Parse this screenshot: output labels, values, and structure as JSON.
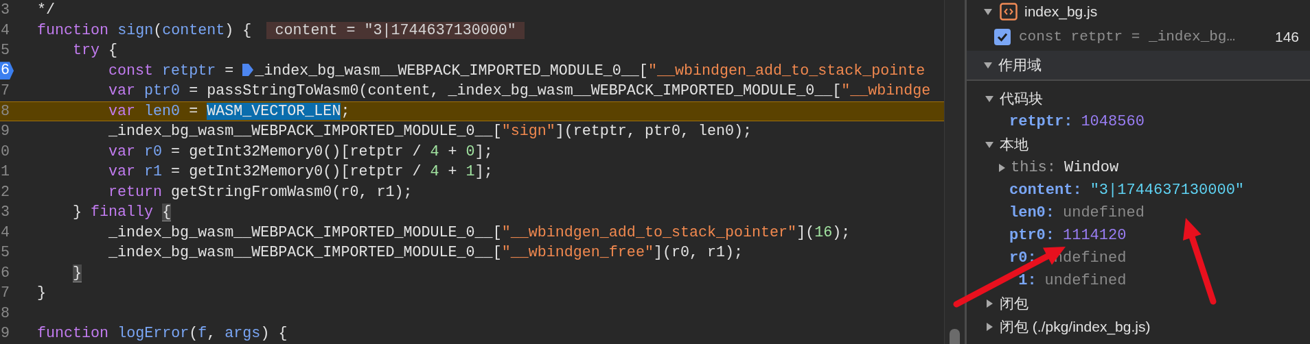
{
  "editor": {
    "lines": [
      {
        "number": "3",
        "breakpoint": false,
        "paused": false,
        "tokens": [
          {
            "kind": "plain",
            "text": "*/"
          }
        ]
      },
      {
        "number": "4",
        "breakpoint": false,
        "paused": false,
        "tokens": [
          {
            "kind": "keyword",
            "text": "function"
          },
          {
            "kind": "ident",
            "text": "sign"
          },
          {
            "kind": "plain",
            "text": "("
          },
          {
            "kind": "ident",
            "text": "content"
          },
          {
            "kind": "plain",
            "text": ") {"
          },
          {
            "kind": "inline-value",
            "text": "content = \"3|1744637130000\""
          }
        ],
        "children": [
          {
            "number": "5",
            "breakpoint": false,
            "paused": false,
            "tokens": [
              {
                "kind": "keyword",
                "text": "try"
              },
              {
                "kind": "plain",
                "text": "{"
              }
            ],
            "children": [
              {
                "number": "6",
                "breakpoint": true,
                "paused": false,
                "tokens": [
                  {
                    "kind": "keyword",
                    "text": "const"
                  },
                  {
                    "kind": "ident",
                    "text": "retptr"
                  },
                  {
                    "kind": "plain",
                    "text": " = "
                  },
                  {
                    "kind": "column-breakpoint"
                  },
                  {
                    "kind": "plain",
                    "text": "_index_bg_wasm__WEBPACK_IMPORTED_MODULE_0__["
                  },
                  {
                    "kind": "string",
                    "text": "\"__wbindgen_add_to_stack_pointe"
                  }
                ]
              },
              {
                "number": "7",
                "breakpoint": false,
                "paused": false,
                "tokens": [
                  {
                    "kind": "keyword",
                    "text": "var"
                  },
                  {
                    "kind": "ident",
                    "text": "ptr0"
                  },
                  {
                    "kind": "plain",
                    "text": " = passStringToWasm0(content, _index_bg_wasm__WEBPACK_IMPORTED_MODULE_0__["
                  },
                  {
                    "kind": "string",
                    "text": "\"__wbindge"
                  }
                ]
              },
              {
                "number": "8",
                "breakpoint": false,
                "paused": true,
                "tokens": [
                  {
                    "kind": "keyword",
                    "text": "var"
                  },
                  {
                    "kind": "ident",
                    "text": "len0"
                  },
                  {
                    "kind": "plain",
                    "text": " = "
                  },
                  {
                    "kind": "selected",
                    "text": "WASM_VECTOR_LEN"
                  },
                  {
                    "kind": "plain",
                    "text": ";"
                  }
                ]
              },
              {
                "number": "9",
                "breakpoint": false,
                "paused": false,
                "tokens": [
                  {
                    "kind": "plain",
                    "text": "_index_bg_wasm__WEBPACK_IMPORTED_MODULE_0__["
                  },
                  {
                    "kind": "string",
                    "text": "\"sign\""
                  },
                  {
                    "kind": "plain",
                    "text": "](retptr, ptr0, len0);"
                  }
                ]
              },
              {
                "number": "0",
                "breakpoint": false,
                "paused": false,
                "tokens": [
                  {
                    "kind": "keyword",
                    "text": "var"
                  },
                  {
                    "kind": "ident",
                    "text": "r0"
                  },
                  {
                    "kind": "plain",
                    "text": " = getInt32Memory0()[retptr / "
                  },
                  {
                    "kind": "number",
                    "text": "4"
                  },
                  {
                    "kind": "plain",
                    "text": " + "
                  },
                  {
                    "kind": "number",
                    "text": "0"
                  },
                  {
                    "kind": "plain",
                    "text": "];"
                  }
                ]
              },
              {
                "number": "1",
                "breakpoint": false,
                "paused": false,
                "tokens": [
                  {
                    "kind": "keyword",
                    "text": "var"
                  },
                  {
                    "kind": "ident",
                    "text": "r1"
                  },
                  {
                    "kind": "plain",
                    "text": " = getInt32Memory0()[retptr / "
                  },
                  {
                    "kind": "number",
                    "text": "4"
                  },
                  {
                    "kind": "plain",
                    "text": " + "
                  },
                  {
                    "kind": "number",
                    "text": "1"
                  },
                  {
                    "kind": "plain",
                    "text": "];"
                  }
                ]
              },
              {
                "number": "2",
                "breakpoint": false,
                "paused": false,
                "tokens": [
                  {
                    "kind": "keyword",
                    "text": "return"
                  },
                  {
                    "kind": "plain",
                    "text": "getStringFromWasm0(r0, r1);"
                  }
                ]
              }
            ]
          },
          {
            "number": "3",
            "breakpoint": false,
            "paused": false,
            "tokens": [
              {
                "kind": "plain",
                "text": "}"
              },
              {
                "kind": "keyword",
                "text": "finally"
              },
              {
                "kind": "bracket-match",
                "text": "{"
              }
            ],
            "children": [
              {
                "number": "4",
                "breakpoint": false,
                "paused": false,
                "tokens": [
                  {
                    "kind": "plain",
                    "text": "_index_bg_wasm__WEBPACK_IMPORTED_MODULE_0__["
                  },
                  {
                    "kind": "string",
                    "text": "\"__wbindgen_add_to_stack_pointer\""
                  },
                  {
                    "kind": "plain",
                    "text": "]("
                  },
                  {
                    "kind": "number",
                    "text": "16"
                  },
                  {
                    "kind": "plain",
                    "text": ");"
                  }
                ]
              },
              {
                "number": "5",
                "breakpoint": false,
                "paused": false,
                "tokens": [
                  {
                    "kind": "plain",
                    "text": "_index_bg_wasm__WEBPACK_IMPORTED_MODULE_0__["
                  },
                  {
                    "kind": "string",
                    "text": "\"__wbindgen_free\""
                  },
                  {
                    "kind": "plain",
                    "text": "](r0, r1);"
                  }
                ]
              }
            ]
          },
          {
            "number": "6",
            "breakpoint": false,
            "paused": false,
            "tokens": [
              {
                "kind": "bracket-match",
                "text": "}"
              }
            ]
          }
        ]
      },
      {
        "number": "7",
        "breakpoint": false,
        "paused": false,
        "tokens": [
          {
            "kind": "plain",
            "text": "}"
          }
        ]
      },
      {
        "number": "8",
        "breakpoint": false,
        "paused": false
      },
      {
        "number": "9",
        "breakpoint": false,
        "paused": false,
        "tokens": [
          {
            "kind": "keyword",
            "text": "function"
          },
          {
            "kind": "ident",
            "text": "logError"
          },
          {
            "kind": "plain",
            "text": "("
          },
          {
            "kind": "ident",
            "text": "f"
          },
          {
            "kind": "plain",
            "text": ", "
          },
          {
            "kind": "ident",
            "text": "args"
          },
          {
            "kind": "plain",
            "text": ") {"
          }
        ]
      }
    ]
  },
  "sidebar": {
    "breakpoints": {
      "file": "index_bg.js",
      "expanded": true,
      "items": [
        {
          "text": "const retptr = _index_bg…",
          "line": "146",
          "checked": true
        }
      ]
    },
    "scope": {
      "title": "作用域",
      "expanded": true,
      "groups": [
        {
          "label": "代码块",
          "expanded": true,
          "children": [
            {
              "name": "retptr:",
              "value": "1048560",
              "kind": "number"
            }
          ]
        },
        {
          "label": "本地",
          "expanded": true,
          "children": [
            {
              "name": "this:",
              "value": "Window",
              "kind": "object"
            },
            {
              "name": "content:",
              "value": "\"3|1744637130000\"",
              "kind": "string"
            },
            {
              "name": "len0:",
              "value": "undefined",
              "kind": "undefined"
            },
            {
              "name": "ptr0:",
              "value": "1114120",
              "kind": "number"
            },
            {
              "name": "r0:",
              "value": "ndefined",
              "kind": "undefined"
            },
            {
              "name": "1:",
              "value": "undefined",
              "kind": "undefined"
            }
          ]
        },
        {
          "label": "闭包",
          "expanded": false
        },
        {
          "label": "闭包 (./pkg/index_bg.js)",
          "expanded": false
        }
      ]
    }
  },
  "annotations": [
    {
      "kind": "arrow"
    },
    {
      "kind": "arrow"
    }
  ]
}
